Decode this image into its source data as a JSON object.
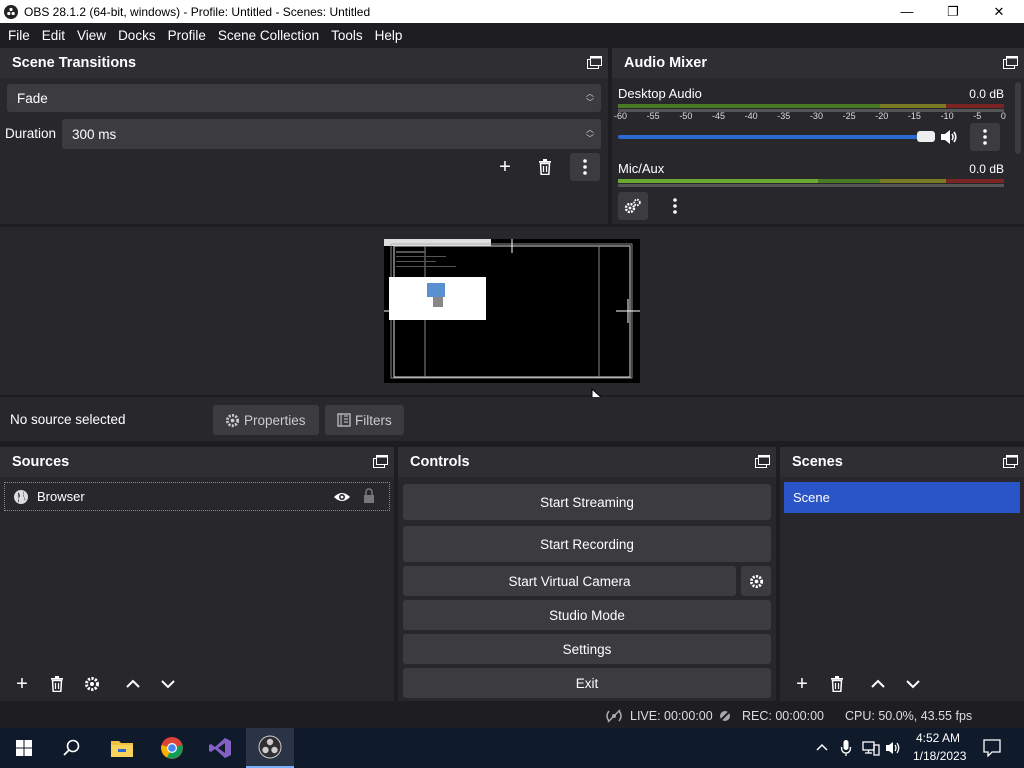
{
  "window": {
    "title": "OBS 28.1.2 (64-bit, windows) - Profile: Untitled - Scenes: Untitled",
    "minimize": "—",
    "maximize": "❐",
    "close": "✕"
  },
  "menu": [
    "File",
    "Edit",
    "View",
    "Docks",
    "Profile",
    "Scene Collection",
    "Tools",
    "Help"
  ],
  "scene_transitions": {
    "title": "Scene Transitions",
    "transition_value": "Fade",
    "duration_label": "Duration",
    "duration_value": "300 ms"
  },
  "audio_mixer": {
    "title": "Audio Mixer",
    "channels": [
      {
        "name": "Desktop Audio",
        "db": "0.0 dB",
        "volume": 0.98
      },
      {
        "name": "Mic/Aux",
        "db": "0.0 dB"
      }
    ],
    "ticks": [
      "-60",
      "-55",
      "-50",
      "-45",
      "-40",
      "-35",
      "-30",
      "-25",
      "-20",
      "-15",
      "-10",
      "-5",
      "0"
    ]
  },
  "source_bar": {
    "status": "No source selected",
    "properties_label": "Properties",
    "filters_label": "Filters"
  },
  "sources": {
    "title": "Sources",
    "items": [
      {
        "name": "Browser"
      }
    ]
  },
  "controls": {
    "title": "Controls",
    "start_streaming": "Start Streaming",
    "start_recording": "Start Recording",
    "start_virtual_camera": "Start Virtual Camera",
    "studio_mode": "Studio Mode",
    "settings": "Settings",
    "exit": "Exit"
  },
  "scenes": {
    "title": "Scenes",
    "items": [
      {
        "name": "Scene"
      }
    ]
  },
  "status": {
    "live": "LIVE: 00:00:00",
    "rec": "REC: 00:00:00",
    "cpu": "CPU: 50.0%, 43.55 fps"
  },
  "taskbar": {
    "time": "4:52 AM",
    "date": "1/18/2023"
  },
  "colors": {
    "accent_blue": "#2a55c8",
    "meter_green": "#5c9c2c",
    "meter_yellow": "#8c8c2c",
    "meter_red": "#8c2c2c"
  }
}
